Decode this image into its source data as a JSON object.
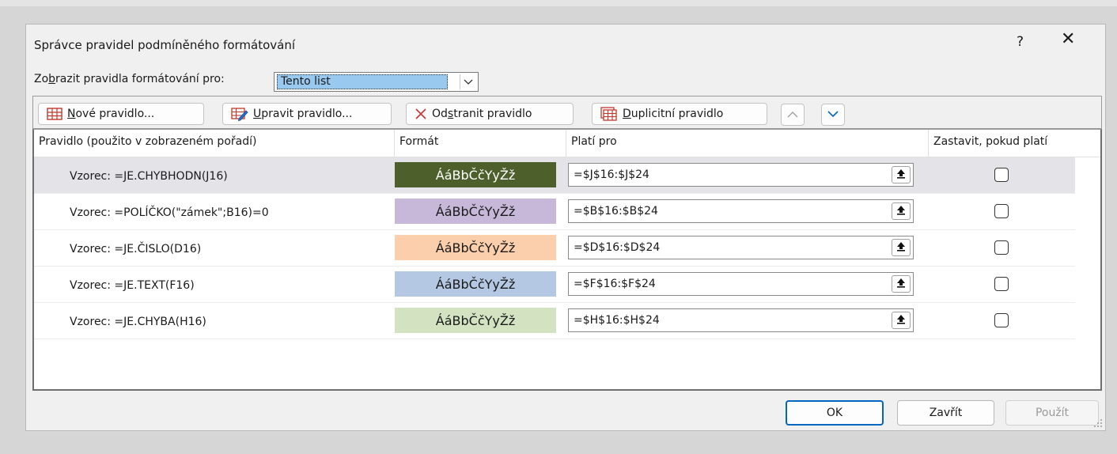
{
  "dialog": {
    "title": "Správce pravidel podmíněného formátování",
    "help_label": "?",
    "close_label": "✕"
  },
  "show_rules": {
    "label_prefix": "Zo",
    "label_accel": "b",
    "label_suffix": "razit pravidla formátování pro:",
    "selected": "Tento list"
  },
  "toolbar": {
    "new_rule": {
      "accel": "N",
      "rest": "ové pravidlo..."
    },
    "edit_rule": {
      "accel": "U",
      "rest": "pravit pravidlo..."
    },
    "delete_rule": {
      "pre": "Od",
      "accel": "s",
      "rest": "tranit pravidlo"
    },
    "duplicate_rule": {
      "accel": "D",
      "rest": "uplicitní pravidlo"
    },
    "move_up_icon": "chevron-up-icon",
    "move_down_icon": "chevron-down-icon"
  },
  "columns": {
    "rule": "Pravidlo (použito v zobrazeném pořadí)",
    "format": "Formát",
    "applies_to": "Platí pro",
    "stop_if_true": "Zastavit, pokud platí"
  },
  "rules": [
    {
      "rule": "Vzorec: =JE.CHYBHODN(J16)",
      "preview": "ÁáBbČčYyŽž",
      "applies_to": "=$J$16:$J$24",
      "bg": "#4d5f2a",
      "fg": "#ffffff",
      "stop": false,
      "selected": true
    },
    {
      "rule": "Vzorec: =POLÍČKO(\"zámek\";B16)=0",
      "preview": "ÁáBbČčYyŽž",
      "applies_to": "=$B$16:$B$24",
      "bg": "#c7b8da",
      "fg": "#1a1a1a",
      "stop": false,
      "selected": false
    },
    {
      "rule": "Vzorec: =JE.ČISLO(D16)",
      "preview": "ÁáBbČčYyŽž",
      "applies_to": "=$D$16:$D$24",
      "bg": "#fbcfac",
      "fg": "#1a1a1a",
      "stop": false,
      "selected": false
    },
    {
      "rule": "Vzorec: =JE.TEXT(F16)",
      "preview": "ÁáBbČčYyŽž",
      "applies_to": "=$F$16:$F$24",
      "bg": "#b4c8e3",
      "fg": "#1a1a1a",
      "stop": false,
      "selected": false
    },
    {
      "rule": "Vzorec: =JE.CHYBA(H16)",
      "preview": "ÁáBbČčYyŽž",
      "applies_to": "=$H$16:$H$24",
      "bg": "#d3e3c2",
      "fg": "#1a1a1a",
      "stop": false,
      "selected": false
    }
  ],
  "footer": {
    "ok": "OK",
    "close": "Zavřít",
    "apply": "Použít"
  },
  "colors": {
    "accent": "#0067c0",
    "selection": "#99c9ef"
  }
}
